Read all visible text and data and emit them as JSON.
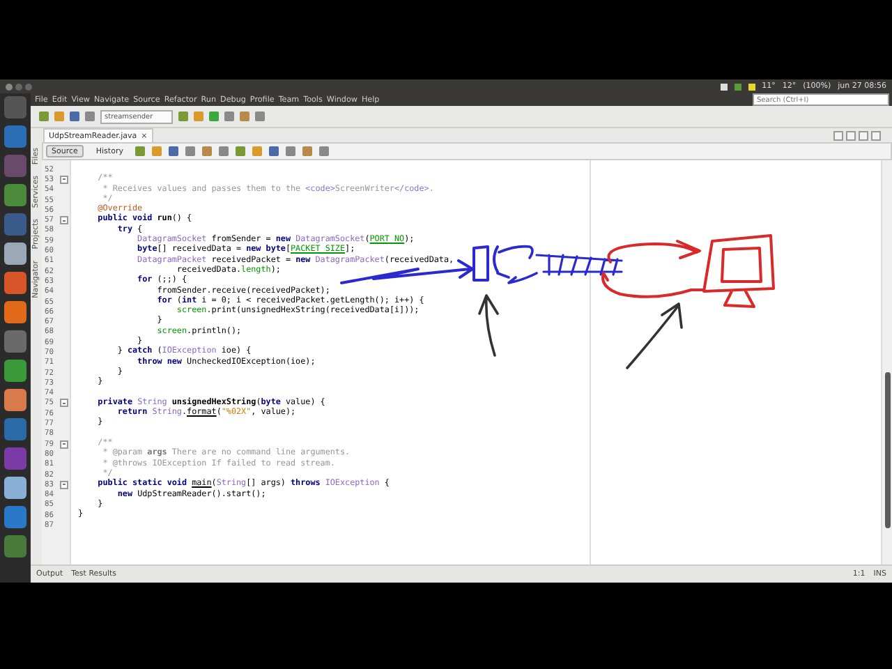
{
  "panel": {
    "status": [
      "11°",
      "12°",
      "(100%)",
      "jun 27 08:56"
    ]
  },
  "menu": [
    "File",
    "Edit",
    "View",
    "Navigate",
    "Source",
    "Refactor",
    "Run",
    "Debug",
    "Profile",
    "Team",
    "Tools",
    "Window",
    "Help"
  ],
  "search": {
    "placeholder": "Search (Ctrl+I)"
  },
  "toolbar": {
    "project": "streamsender"
  },
  "tabs": [
    {
      "label": "UdpStreamReader.java",
      "selected": true,
      "close": "×"
    }
  ],
  "side_tabs": [
    "Files",
    "Services",
    "Projects",
    "Navigator"
  ],
  "editor_modes": [
    {
      "label": "Source",
      "selected": true
    },
    {
      "label": "History",
      "selected": false
    }
  ],
  "lines": [
    {
      "number": "52",
      "fold": false
    },
    {
      "number": "53",
      "fold": true,
      "tokens": [
        {
          "kind": "cmt",
          "text": "    /**"
        }
      ]
    },
    {
      "number": "54",
      "fold": false,
      "tokens": [
        {
          "kind": "cmt",
          "text": "     * Receives values and passes them to the "
        },
        {
          "kind": "html",
          "text": "<code>"
        },
        {
          "kind": "cmt",
          "text": "ScreenWriter"
        },
        {
          "kind": "html",
          "text": "</code>"
        },
        {
          "kind": "cmt",
          "text": "."
        }
      ]
    },
    {
      "number": "55",
      "fold": false,
      "tokens": [
        {
          "kind": "cmt",
          "text": "     */"
        }
      ]
    },
    {
      "number": "56",
      "fold": false,
      "tokens": [
        {
          "kind": "ann",
          "text": "    @Override"
        }
      ]
    },
    {
      "number": "57",
      "fold": true,
      "tokens": [
        {
          "kind": "kw",
          "text": "    public void "
        },
        {
          "kind": "decl",
          "text": "run"
        },
        {
          "kind": "plain",
          "text": "() {"
        }
      ]
    },
    {
      "number": "58",
      "fold": false,
      "tokens": [
        {
          "kind": "kw",
          "text": "        try"
        },
        {
          "kind": "plain",
          "text": " {"
        }
      ]
    },
    {
      "number": "59",
      "fold": false,
      "tokens": [
        {
          "kind": "type",
          "text": "            DatagramSocket"
        },
        {
          "kind": "plain",
          "text": " fromSender = "
        },
        {
          "kind": "kw",
          "text": "new "
        },
        {
          "kind": "type",
          "text": "DatagramSocket"
        },
        {
          "kind": "plain",
          "text": "("
        },
        {
          "kind": "const",
          "text": "PORT_NO"
        },
        {
          "kind": "plain",
          "text": ");"
        }
      ]
    },
    {
      "number": "60",
      "fold": false,
      "tokens": [
        {
          "kind": "kw",
          "text": "            byte"
        },
        {
          "kind": "plain",
          "text": "[] receivedData = "
        },
        {
          "kind": "kw",
          "text": "new byte"
        },
        {
          "kind": "plain",
          "text": "["
        },
        {
          "kind": "const",
          "text": "PACKET_SIZE"
        },
        {
          "kind": "plain",
          "text": "];"
        }
      ]
    },
    {
      "number": "61",
      "fold": false,
      "tokens": [
        {
          "kind": "type",
          "text": "            DatagramPacket"
        },
        {
          "kind": "plain",
          "text": " receivedPacket = "
        },
        {
          "kind": "kw",
          "text": "new "
        },
        {
          "kind": "type",
          "text": "DatagramPacket"
        },
        {
          "kind": "plain",
          "text": "(receivedData,"
        }
      ]
    },
    {
      "number": "62",
      "fold": false,
      "tokens": [
        {
          "kind": "plain",
          "text": "                    receivedData."
        },
        {
          "kind": "field",
          "text": "length"
        },
        {
          "kind": "plain",
          "text": ");"
        }
      ]
    },
    {
      "number": "63",
      "fold": false,
      "tokens": [
        {
          "kind": "kw",
          "text": "            for"
        },
        {
          "kind": "plain",
          "text": " (;;) {"
        }
      ]
    },
    {
      "number": "64",
      "fold": false,
      "tokens": [
        {
          "kind": "plain",
          "text": "                fromSender.receive(receivedPacket);"
        }
      ]
    },
    {
      "number": "65",
      "fold": false,
      "tokens": [
        {
          "kind": "kw",
          "text": "                for"
        },
        {
          "kind": "plain",
          "text": " ("
        },
        {
          "kind": "kw",
          "text": "int"
        },
        {
          "kind": "plain",
          "text": " i = 0; i < receivedPacket.getLength(); i++) {"
        }
      ]
    },
    {
      "number": "66",
      "fold": false,
      "tokens": [
        {
          "kind": "field",
          "text": "                    screen"
        },
        {
          "kind": "plain",
          "text": ".print(unsignedHexString(receivedData[i]));"
        }
      ]
    },
    {
      "number": "67",
      "fold": false,
      "tokens": [
        {
          "kind": "plain",
          "text": "                }"
        }
      ]
    },
    {
      "number": "68",
      "fold": false,
      "tokens": [
        {
          "kind": "field",
          "text": "                screen"
        },
        {
          "kind": "plain",
          "text": ".println();"
        }
      ]
    },
    {
      "number": "69",
      "fold": false,
      "tokens": [
        {
          "kind": "plain",
          "text": "            }"
        }
      ]
    },
    {
      "number": "70",
      "fold": false,
      "tokens": [
        {
          "kind": "plain",
          "text": "        } "
        },
        {
          "kind": "kw",
          "text": "catch"
        },
        {
          "kind": "plain",
          "text": " ("
        },
        {
          "kind": "type",
          "text": "IOException"
        },
        {
          "kind": "plain",
          "text": " ioe) {"
        }
      ]
    },
    {
      "number": "71",
      "fold": false,
      "tokens": [
        {
          "kind": "kw",
          "text": "            throw new "
        },
        {
          "kind": "plain",
          "text": "UncheckedIOException(ioe);"
        }
      ]
    },
    {
      "number": "72",
      "fold": false,
      "tokens": [
        {
          "kind": "plain",
          "text": "        }"
        }
      ]
    },
    {
      "number": "73",
      "fold": false,
      "tokens": [
        {
          "kind": "plain",
          "text": "    }"
        }
      ]
    },
    {
      "number": "74",
      "fold": false
    },
    {
      "number": "75",
      "fold": true,
      "tokens": [
        {
          "kind": "kw",
          "text": "    private "
        },
        {
          "kind": "type",
          "text": "String "
        },
        {
          "kind": "decl",
          "text": "unsignedHexString"
        },
        {
          "kind": "plain",
          "text": "("
        },
        {
          "kind": "kw",
          "text": "byte"
        },
        {
          "kind": "plain",
          "text": " value) {"
        }
      ]
    },
    {
      "number": "76",
      "fold": false,
      "tokens": [
        {
          "kind": "kw",
          "text": "        return "
        },
        {
          "kind": "type",
          "text": "String"
        },
        {
          "kind": "plain",
          "text": "."
        },
        {
          "kind": "link",
          "text": "format"
        },
        {
          "kind": "plain",
          "text": "("
        },
        {
          "kind": "str",
          "text": "\"%02X\""
        },
        {
          "kind": "plain",
          "text": ", value);"
        }
      ]
    },
    {
      "number": "77",
      "fold": false,
      "tokens": [
        {
          "kind": "plain",
          "text": "    }"
        }
      ]
    },
    {
      "number": "78",
      "fold": false
    },
    {
      "number": "79",
      "fold": true,
      "tokens": [
        {
          "kind": "cmt",
          "text": "    /**"
        }
      ]
    },
    {
      "number": "80",
      "fold": false,
      "tokens": [
        {
          "kind": "cmt",
          "text": "     * @param "
        },
        {
          "kind": "cmtb",
          "text": "args"
        },
        {
          "kind": "cmt",
          "text": " There are no command line arguments."
        }
      ]
    },
    {
      "number": "81",
      "fold": false,
      "tokens": [
        {
          "kind": "cmt",
          "text": "     * @throws IOException If failed to read stream."
        }
      ]
    },
    {
      "number": "82",
      "fold": false,
      "tokens": [
        {
          "kind": "cmt",
          "text": "     */"
        }
      ]
    },
    {
      "number": "83",
      "fold": true,
      "tokens": [
        {
          "kind": "kw",
          "text": "    public static void "
        },
        {
          "kind": "link",
          "text": "main"
        },
        {
          "kind": "plain",
          "text": "("
        },
        {
          "kind": "type",
          "text": "String"
        },
        {
          "kind": "plain",
          "text": "[] args) "
        },
        {
          "kind": "kw",
          "text": "throws "
        },
        {
          "kind": "type",
          "text": "IOException"
        },
        {
          "kind": "plain",
          "text": " {"
        }
      ]
    },
    {
      "number": "84",
      "fold": false,
      "tokens": [
        {
          "kind": "kw",
          "text": "        new "
        },
        {
          "kind": "plain",
          "text": "UdpStreamReader().start();"
        }
      ]
    },
    {
      "number": "85",
      "fold": false,
      "tokens": [
        {
          "kind": "plain",
          "text": "    }"
        }
      ]
    },
    {
      "number": "86",
      "fold": false,
      "tokens": [
        {
          "kind": "plain",
          "text": "}"
        }
      ]
    },
    {
      "number": "87",
      "fold": false
    }
  ],
  "bottom_tabs": [
    "Output",
    "Test Results"
  ],
  "status_bar": {
    "position": "1:1",
    "mode": "INS"
  }
}
